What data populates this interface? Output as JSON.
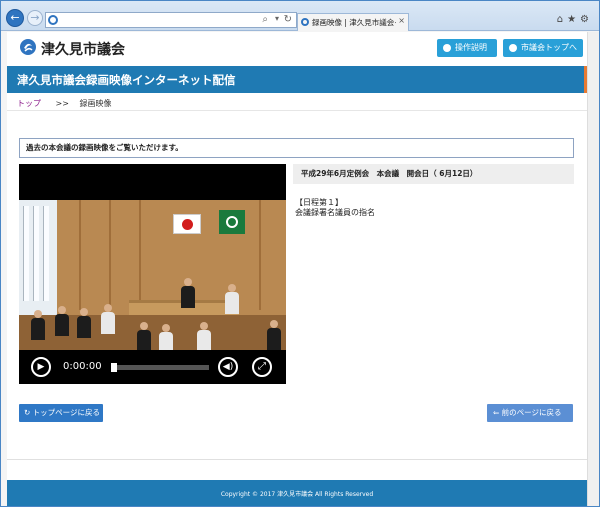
{
  "browser": {
    "back_glyph": "←",
    "forward_glyph": "→",
    "search_glyph": "⌕",
    "dropdown_glyph": "▾",
    "reload_glyph": "↻",
    "tab_title": "録画映像 | 津久見市議会イ...",
    "tab_close": "×",
    "toolbar_icons": "⌂★⚙",
    "icons": [
      "back-arrow-icon",
      "forward-arrow-icon",
      "site-icon",
      "search-icon",
      "reload-icon",
      "close-icon",
      "home-icon",
      "favorites-icon",
      "settings-icon"
    ]
  },
  "header": {
    "site_name": "津久見市議会",
    "guide_button": "操作説明",
    "top_button": "市議会トップへ"
  },
  "banner": {
    "title": "津久見市議会録画映像インターネット配信"
  },
  "breadcrumb": {
    "top": "トップ",
    "sep": ">>",
    "current": "録画映像"
  },
  "notice": "過去の本会議の録画映像をご覧いただけます。",
  "player": {
    "time": "0:00:00",
    "progress": 0,
    "play_icon": "▶",
    "volume_icon": "◀)",
    "fullscreen_icon": "⤢"
  },
  "meeting": {
    "title": "平成29年6月定例会　本会議　開会日（ 6月12日）",
    "agenda_label": "【日程第１】",
    "agenda_item": "会議録署名議員の指名"
  },
  "nav": {
    "home_button": "トップページに戻る",
    "back_button": "前のページに戻る"
  },
  "footer": {
    "copyright": "Copyright © 2017 津久見市議会 All Rights Reserved"
  },
  "colors": {
    "brand": "#1f7ab3",
    "button": "#29a0d8",
    "accent": "#e87a32"
  }
}
